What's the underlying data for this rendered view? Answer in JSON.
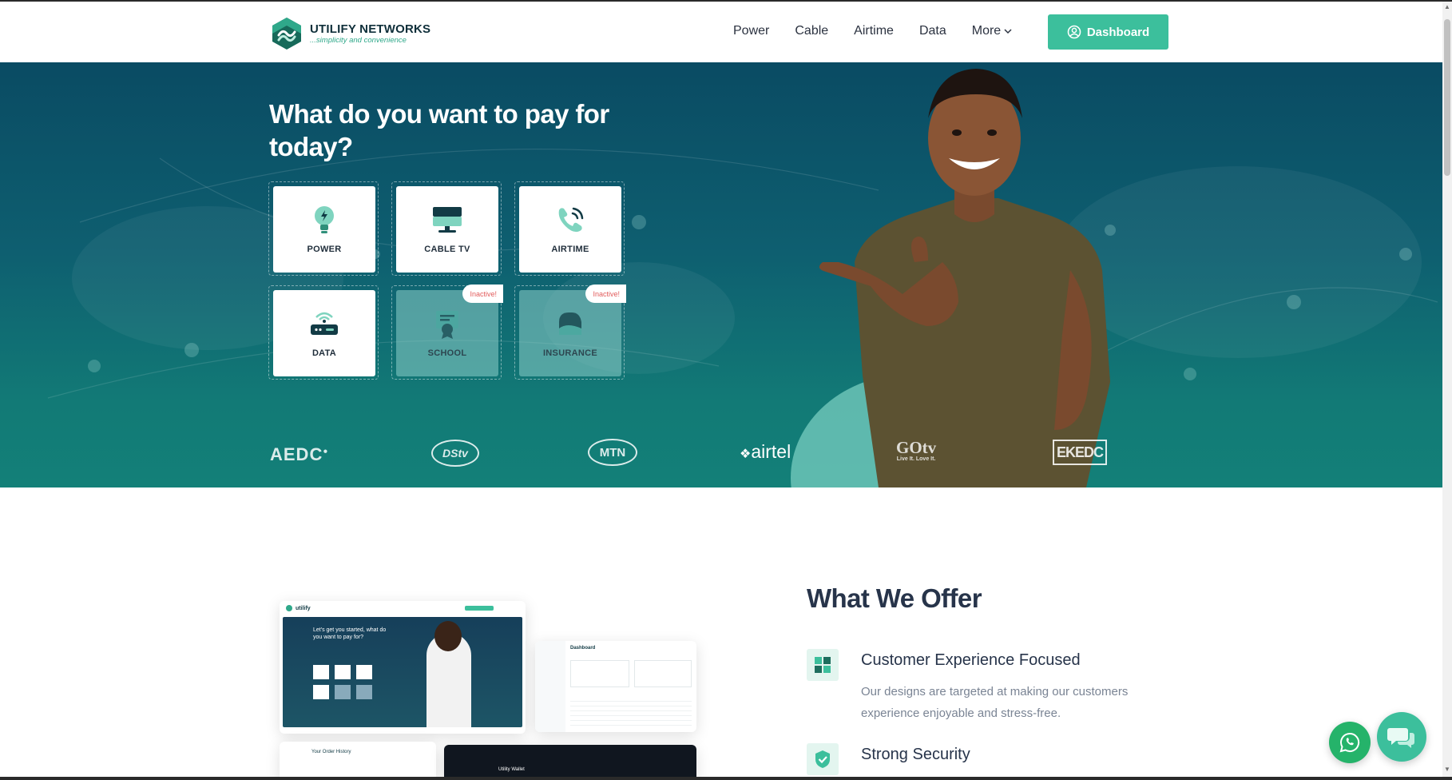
{
  "header": {
    "brand_name": "UTILIFY NETWORKS",
    "brand_tagline": "...simplicity and convenience",
    "nav": [
      "Power",
      "Cable",
      "Airtime",
      "Data",
      "More"
    ],
    "dashboard_label": "Dashboard"
  },
  "hero": {
    "title": "What do you want to pay for today?",
    "services": [
      {
        "label": "POWER",
        "icon": "bulb-icon",
        "inactive": false
      },
      {
        "label": "CABLE TV",
        "icon": "tv-icon",
        "inactive": false
      },
      {
        "label": "AIRTIME",
        "icon": "phone-icon",
        "inactive": false
      },
      {
        "label": "DATA",
        "icon": "router-icon",
        "inactive": false
      },
      {
        "label": "SCHOOL",
        "icon": "certificate-icon",
        "inactive": true,
        "badge": "Inactive!"
      },
      {
        "label": "INSURANCE",
        "icon": "insurance-icon",
        "inactive": true,
        "badge": "Inactive!"
      }
    ],
    "brands": [
      "AEDC",
      "DStv",
      "MTN",
      "airtel",
      "GOtv",
      "EKEDC"
    ],
    "gotv_tagline": "Live It. Love It."
  },
  "offer": {
    "title": "What We Offer",
    "features": [
      {
        "title": "Customer Experience Focused",
        "description": "Our designs are targeted at making our customers experience enjoyable and stress-free.",
        "icon": "grid-icon"
      },
      {
        "title": "Strong Security",
        "description": "",
        "icon": "shield-check-icon"
      }
    ],
    "mockup": {
      "brand": "utilify",
      "hero_text": "Let's get you started, what do you want to pay for?",
      "dashboard_title": "Dashboard",
      "history_title": "Your Order History",
      "wallet_title": "Utility Wallet"
    }
  },
  "colors": {
    "accent": "#3cbf9c",
    "hero_top": "#0a4b63",
    "hero_bottom": "#138078",
    "inactive_badge": "#e25c5c",
    "whatsapp": "#25b36a"
  }
}
